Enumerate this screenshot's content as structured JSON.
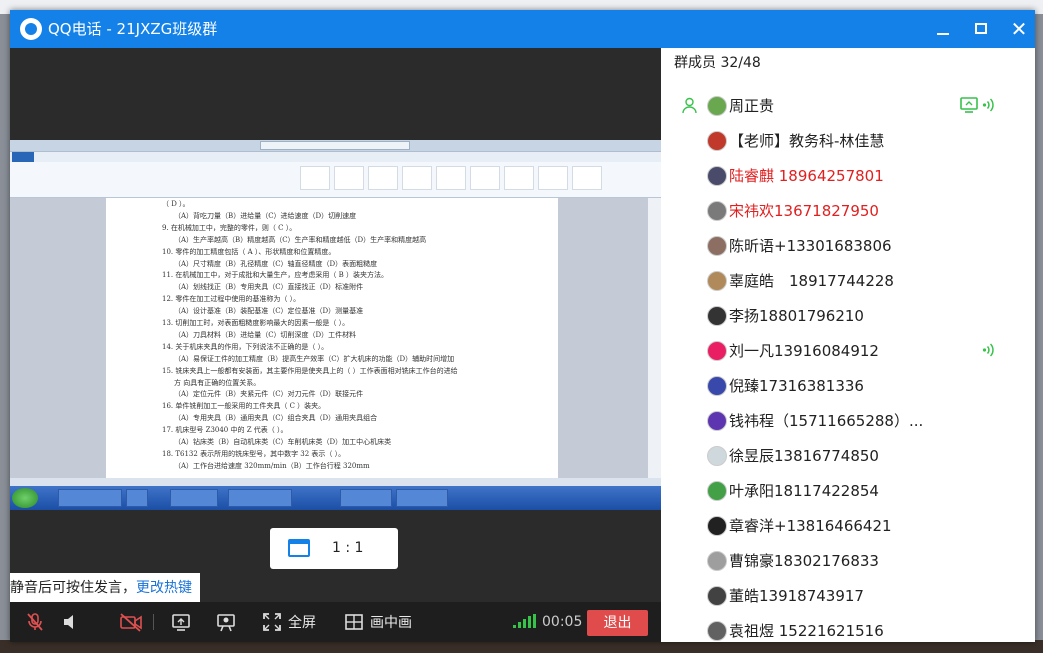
{
  "window": {
    "title": "QQ电话 - 21JXZG班级群",
    "minimize_icon": "minimize-icon",
    "maximize_icon": "maximize-icon",
    "close_icon": "close-icon",
    "close_glyph": "✕"
  },
  "video": {
    "aspect_label": "1 : 1",
    "aspect_icon": "screen-ratio-icon",
    "shared_screen_lines": [
      "（ D ）。",
      "（A）背吃刀量（B）进给量（C）进给速度（D）切削速度",
      "9. 在机械加工中，完整的零件，则（ C ）。",
      "（A）生产率越高（B）精度越高（C）生产率和精度越低（D）生产率和精度越高",
      "10. 零件的加工精度包括（ A ）、形状精度和位置精度。",
      "（A）尺寸精度（B）孔径精度（C）轴直径精度（D）表面粗糙度",
      "11. 在机械加工中，对于成批和大量生产，应考虑采用（ B ）装夹方法。",
      "（A）划线找正（B）专用夹具（C）直接找正（D）标准附件",
      "12. 零件在加工过程中使用的基准称为（ ）。",
      "（A）设计基准（B）装配基准（C）定位基准（D）测量基准",
      "13. 切削加工时，对表面粗糙度影响最大的因素一般是（ ）。",
      "（A）刀具材料（B）进给量（C）切削深度（D）工件材料",
      "14. 关于机床夹具的作用，下列说法不正确的是（ ）。",
      "（A）易保证工件的加工精度（B）提高生产效率（C）扩大机床的功能（D）辅助时间增加",
      "15. 铣床夹具上一般都有安装面，其主要作用是使夹具上的（ ）工作表面相对铣床工作台的进给",
      "方 向具有正确的位置关系。",
      "（A）定位元件（B）夹紧元件（C）对刀元件（D）联接元件",
      "16. 单件铣削加工一般采用的工件夹具（ C ）装夹。",
      "（A）专用夹具（B）通用夹具（C）组合夹具（D）通用夹具组合",
      "17. 机床型号 Z3040 中的 Z 代表（ ）。",
      "（A）钻床类（B）自动机床类（C）车削机床类（D）加工中心机床类",
      "18. T6132 表示所用的铣床型号，其中数字 32 表示（ ）。",
      "（A）工作台进给速度 320mm/min（B）工作台行程 320mm"
    ]
  },
  "tip": {
    "text": "静音后可按住发言，",
    "link": "更改热键"
  },
  "controls": {
    "mic_icon": "mic-muted-icon",
    "speaker_icon": "speaker-icon",
    "camera_icon": "camera-off-icon",
    "share_screen_icon": "share-screen-icon",
    "whiteboard_icon": "whiteboard-icon",
    "fullscreen_icon": "fullscreen-icon",
    "fullscreen_label": "全屏",
    "pip_icon": "picture-in-picture-icon",
    "pip_label": "画中画",
    "signal_icon": "signal-strength-icon",
    "timer": "00:05",
    "exit_label": "退出",
    "exit_color": "#e04b4b"
  },
  "members": {
    "header": "群成员 32/48",
    "list": [
      {
        "name": "周正贵",
        "avatar_color": "#6aa84f",
        "host": true,
        "sharing": true,
        "speaking": true,
        "red": false
      },
      {
        "name": "【老师】教务科-林佳慧",
        "avatar_color": "#c0392b",
        "host": false,
        "sharing": false,
        "speaking": false,
        "red": false
      },
      {
        "name": "陆睿麒 18964257801",
        "avatar_color": "#4a4a6a",
        "host": false,
        "sharing": false,
        "speaking": false,
        "red": true
      },
      {
        "name": "宋祎欢13671827950",
        "avatar_color": "#7a7a7a",
        "host": false,
        "sharing": false,
        "speaking": false,
        "red": true
      },
      {
        "name": "陈昕语+13301683806",
        "avatar_color": "#8d6e63",
        "host": false,
        "sharing": false,
        "speaking": false,
        "red": false
      },
      {
        "name": "辜庭皓　18917744228",
        "avatar_color": "#b08a5a",
        "host": false,
        "sharing": false,
        "speaking": false,
        "red": false
      },
      {
        "name": "李扬18801796210",
        "avatar_color": "#333333",
        "host": false,
        "sharing": false,
        "speaking": false,
        "red": false
      },
      {
        "name": "刘一凡13916084912",
        "avatar_color": "#e91e63",
        "host": false,
        "sharing": false,
        "speaking": true,
        "red": false
      },
      {
        "name": "倪臻17316381336",
        "avatar_color": "#3949ab",
        "host": false,
        "sharing": false,
        "speaking": false,
        "red": false
      },
      {
        "name": "钱祎程（15711665288）...",
        "avatar_color": "#5e35b1",
        "host": false,
        "sharing": false,
        "speaking": false,
        "red": false
      },
      {
        "name": "徐昱辰13816774850",
        "avatar_color": "#cfd8dc",
        "host": false,
        "sharing": false,
        "speaking": false,
        "red": false
      },
      {
        "name": "叶承阳18117422854",
        "avatar_color": "#43a047",
        "host": false,
        "sharing": false,
        "speaking": false,
        "red": false
      },
      {
        "name": "章睿洋+13816466421",
        "avatar_color": "#212121",
        "host": false,
        "sharing": false,
        "speaking": false,
        "red": false
      },
      {
        "name": "曹锦豪18302176833",
        "avatar_color": "#9e9e9e",
        "host": false,
        "sharing": false,
        "speaking": false,
        "red": false
      },
      {
        "name": "董皓13918743917",
        "avatar_color": "#424242",
        "host": false,
        "sharing": false,
        "speaking": false,
        "red": false
      },
      {
        "name": "袁祖煜 15221621516",
        "avatar_color": "#616161",
        "host": false,
        "sharing": false,
        "speaking": false,
        "red": false
      }
    ]
  },
  "colors": {
    "titlebar": "#1481e8",
    "speaking": "#37c24a",
    "link": "#1a73d9"
  }
}
